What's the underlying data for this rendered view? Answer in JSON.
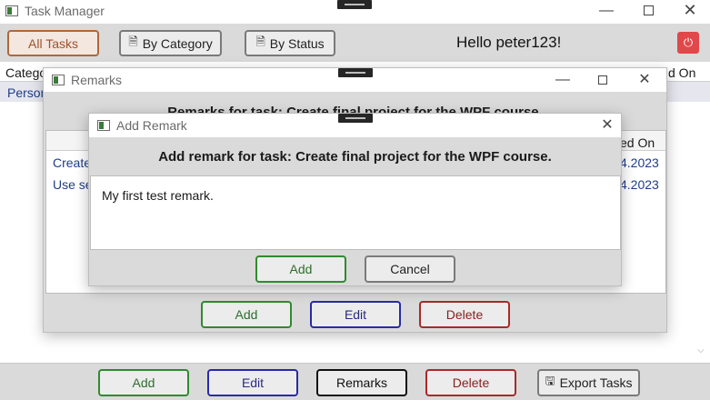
{
  "main": {
    "title": "Task Manager",
    "toolbar": {
      "all_tasks": "All Tasks",
      "by_category": "By Category",
      "by_status": "By Status",
      "greeting": "Hello peter123!"
    },
    "grid_headers": {
      "category_partial": "Catego",
      "on_partial": "d On"
    },
    "grid_row_partial": "Person",
    "bottom": {
      "add": "Add",
      "edit": "Edit",
      "remarks": "Remarks",
      "delete": "Delete",
      "export": "Export Tasks"
    }
  },
  "remarks_window": {
    "title": "Remarks",
    "heading": "Remarks for task: Create final project for the WPF course.",
    "header_right": "ed On",
    "rows": [
      {
        "left": "Create",
        "right": "4.2023"
      },
      {
        "left": "Use se",
        "right": "4.2023"
      }
    ],
    "buttons": {
      "add": "Add",
      "edit": "Edit",
      "delete": "Delete"
    }
  },
  "add_remark_dialog": {
    "title": "Add Remark",
    "heading": "Add remark for task: Create final project for the WPF course.",
    "text_value": "My first test remark.",
    "buttons": {
      "add": "Add",
      "cancel": "Cancel"
    }
  },
  "colors": {
    "accent_power": "#e0484a",
    "link_text": "#1f3d8a"
  }
}
